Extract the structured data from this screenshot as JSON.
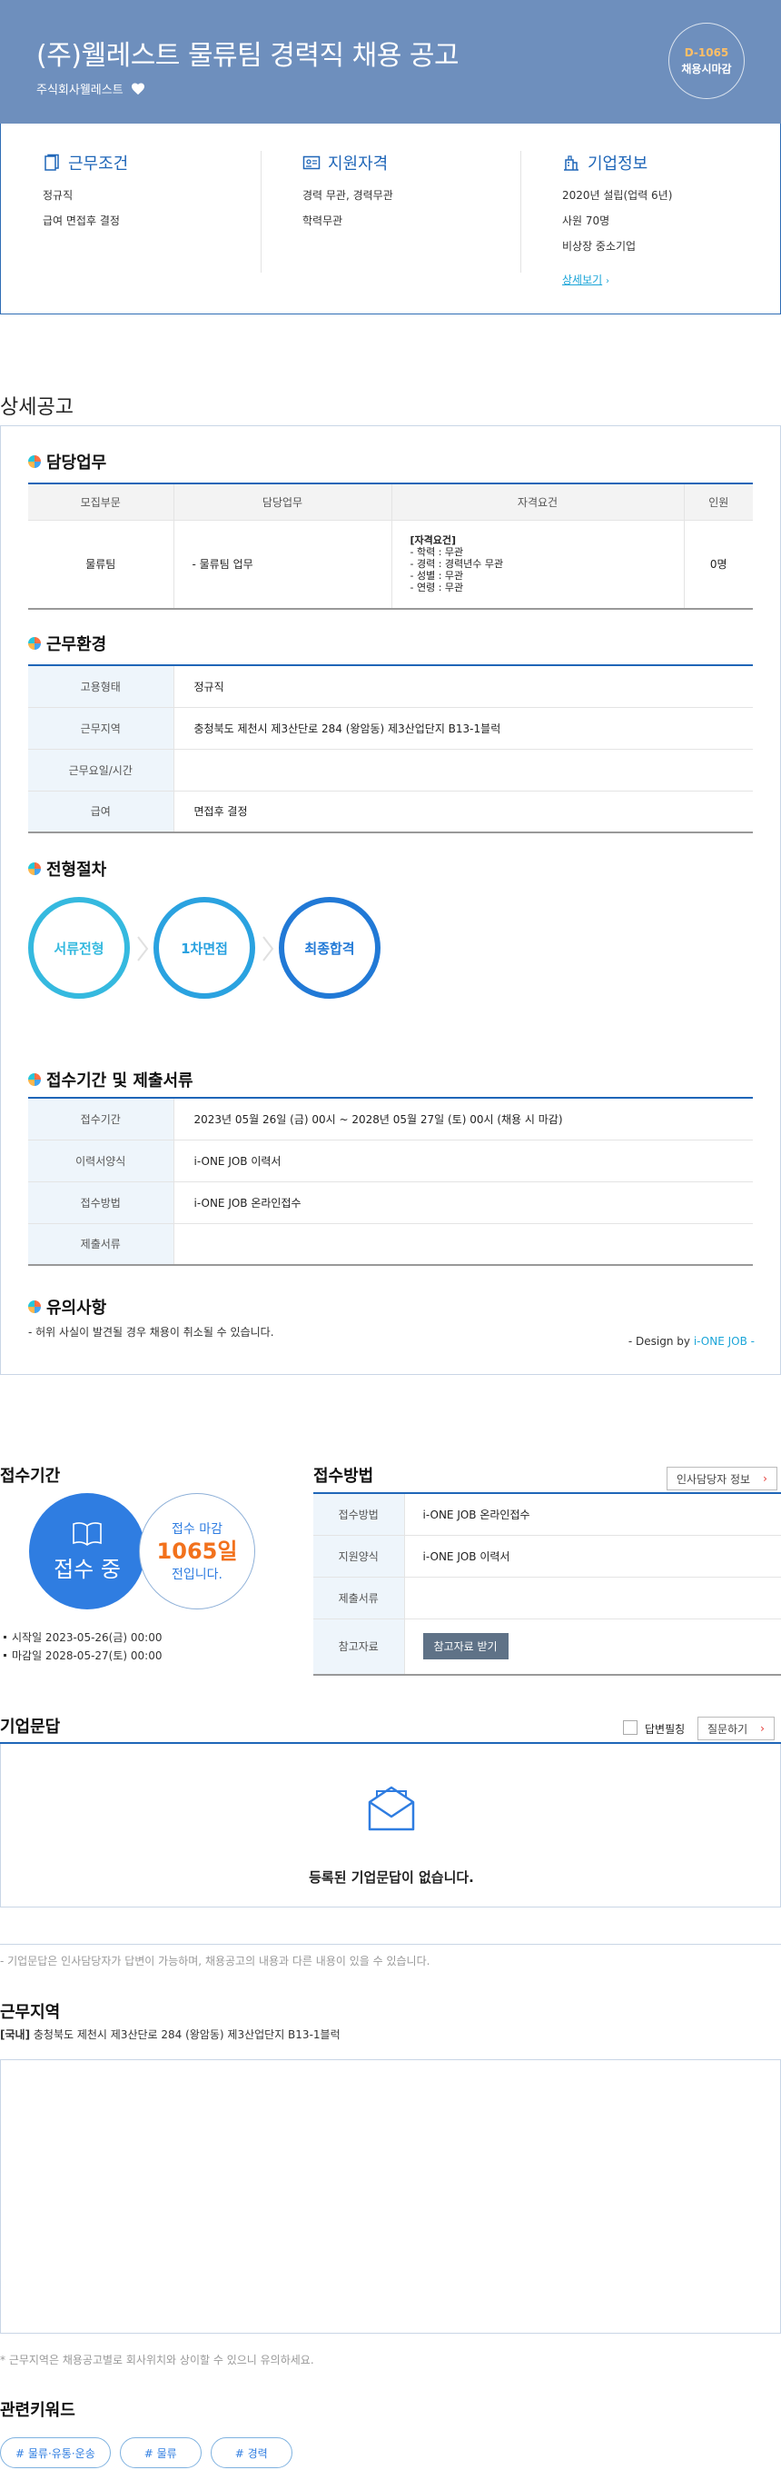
{
  "header": {
    "title": "(주)웰레스트 물류팀 경력직 채용 공고",
    "company": "주식회사웰레스트",
    "dday": "D-1065",
    "dday_label": "채용시마감"
  },
  "summary": {
    "work": {
      "title": "근무조건",
      "lines": [
        "정규직",
        "급여 면접후 결정"
      ]
    },
    "qualification": {
      "title": "지원자격",
      "lines": [
        "경력 무관, 경력무관",
        "학력무관"
      ]
    },
    "company": {
      "title": "기업정보",
      "lines": [
        "2020년 설립(업력 6년)",
        "사원 70명",
        "비상장 중소기업"
      ],
      "link": "상세보기"
    }
  },
  "detail": {
    "title": "상세공고",
    "duty": {
      "heading": "담당업무",
      "columns": [
        "모집부문",
        "담당업무",
        "자격요건",
        "인원"
      ],
      "row": {
        "division": "물류팀",
        "task": "- 물류팀 업무",
        "req_title": "[자격요건]",
        "req_lines": [
          "- 학력 : 무관",
          "- 경력 : 경력년수 무관",
          "- 성별 : 무관",
          "- 연령 : 무관"
        ],
        "count": "0명"
      }
    },
    "environment": {
      "heading": "근무환경",
      "rows": [
        {
          "label": "고용형태",
          "value": "정규직"
        },
        {
          "label": "근무지역",
          "value": "충청북도 제천시 제3산단로 284 (왕암동) 제3산업단지 B13-1블럭"
        },
        {
          "label": "근무요일/시간",
          "value": ""
        },
        {
          "label": "급여",
          "value": "면접후 결정"
        }
      ]
    },
    "process": {
      "heading": "전형절차",
      "steps": [
        "서류전형",
        "1차면접",
        "최종합격"
      ],
      "colors": [
        "#35b9df",
        "#2aa2e0",
        "#2179d6"
      ]
    },
    "period": {
      "heading": "접수기간 및 제출서류",
      "rows": [
        {
          "label": "접수기간",
          "value": "2023년 05월 26일 (금) 00시 ~ 2028년 05월 27일 (토) 00시 (채용 시 마감)"
        },
        {
          "label": "이력서양식",
          "value": "i-ONE JOB 이력서"
        },
        {
          "label": "접수방법",
          "value": "i-ONE JOB 온라인접수"
        },
        {
          "label": "제출서류",
          "value": ""
        }
      ]
    },
    "caution": {
      "heading": "유의사항",
      "text": "- 허위 사실이 발견될 경우 채용이 취소될 수 있습니다."
    },
    "design_prefix": "- Design by ",
    "design_brand": "i-ONE JOB -"
  },
  "apply": {
    "period_title": "접수기간",
    "status": "접수 중",
    "deadline_label": "접수 마감",
    "days_left": "1065일",
    "days_suffix": "전입니다.",
    "start": "시작일 2023-05-26(금) 00:00",
    "end": "마감일 2028-05-27(토) 00:00",
    "method_title": "접수방법",
    "hr_button": "인사담당자 정보",
    "rows": [
      {
        "label": "접수방법",
        "value": "i-ONE JOB 온라인접수"
      },
      {
        "label": "지원양식",
        "value": "i-ONE JOB 이력서"
      },
      {
        "label": "제출서류",
        "value": ""
      },
      {
        "label": "참고자료",
        "value": ""
      }
    ],
    "ref_button": "참고자료 받기"
  },
  "qna": {
    "title": "기업문답",
    "checkbox_label": "답변필칭",
    "ask_button": "질문하기",
    "empty": "등록된 기업문답이 없습니다.",
    "note": "- 기업문답은 인사담당자가 답변이 가능하며, 채용공고의 내용과 다른 내용이 있을 수 있습니다."
  },
  "location": {
    "title": "근무지역",
    "tag": "[국내]",
    "address": " 충청북도 제천시 제3산단로 284 (왕암동) 제3산업단지 B13-1블럭",
    "note": "* 근무지역은 채용공고별로 회사위치와 상이할 수 있으니 유의하세요."
  },
  "keywords": {
    "title": "관련키워드",
    "items": [
      "# 물류·유통·운송",
      "# 물류",
      "# 경력"
    ]
  }
}
